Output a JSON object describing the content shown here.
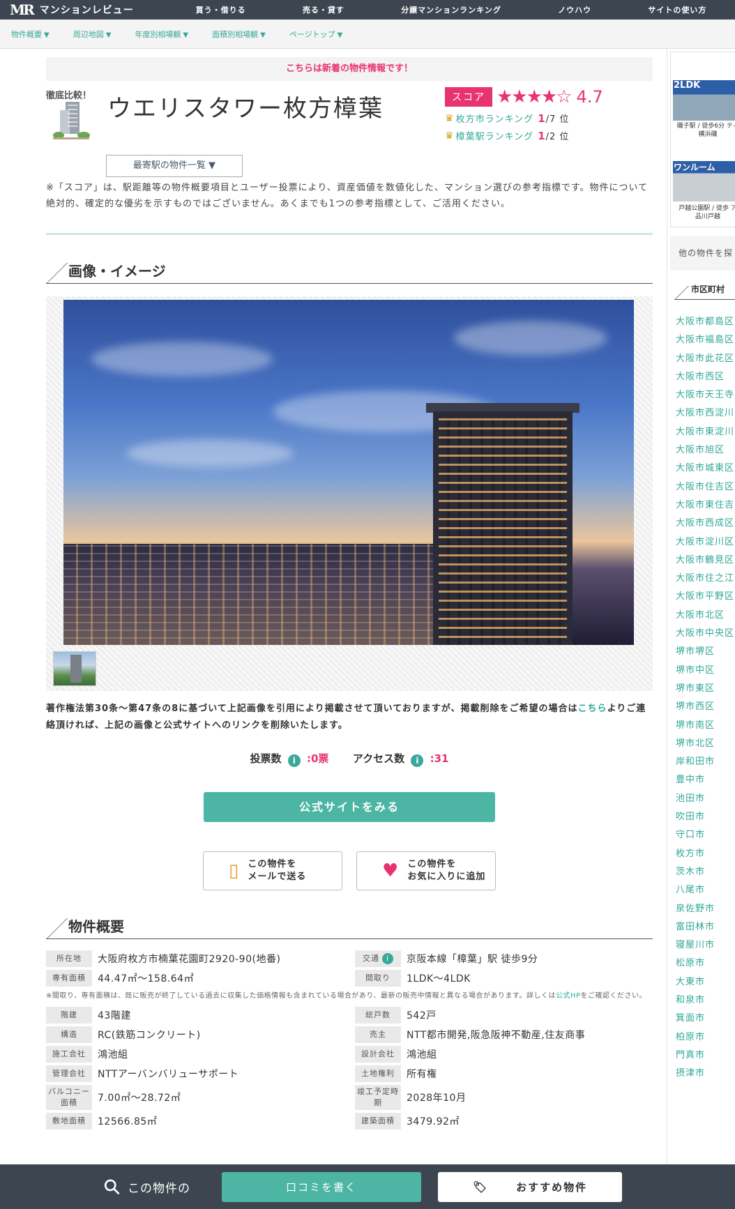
{
  "header": {
    "logo_mark": "MR",
    "site_name": "マンションレビュー",
    "nav": [
      "買う・借りる",
      "売る・貸す",
      "分譲マンションランキング",
      "ノウハウ",
      "サイトの使い方"
    ]
  },
  "subnav": [
    "物件概要",
    "周辺地図",
    "年度別相場観",
    "面積別相場観",
    "ページトップ"
  ],
  "notice": "こちらは新着の物件情報です！",
  "property": {
    "compare_label": "徹底比較！",
    "name": "ウエリスタワー枚方樟葉",
    "nearest_button": "最寄駅の物件一覧 ▼",
    "score_label": "スコア",
    "stars": "★★★★☆",
    "score": "4.7",
    "rankings": [
      {
        "label": "枚方市ランキング",
        "rank": "1",
        "total": "/7 位"
      },
      {
        "label": "樟葉駅ランキング",
        "rank": "1",
        "total": "/2 位"
      }
    ]
  },
  "description": "※「スコア」は、駅距離等の物件概要項目とユーザー投票により、資産価値を数値化した、マンション選びの参考指標です。物件について絶対的、確定的な優劣を示すものではございません。あくまでも1つの参考指標として、ご活用ください。",
  "images_section_title": "画像・イメージ",
  "copyright": {
    "text1": "著作権法第30条～第47条の8に基づいて上記画像を引用により掲載させて頂いておりますが、掲載削除をご希望の場合は",
    "link": "こちら",
    "text2": "よりご連絡頂ければ、上記の画像と公式サイトへのリンクを削除いたします。"
  },
  "counts": {
    "votes_label": "投票数",
    "votes_value": ":0票",
    "access_label": "アクセス数",
    "access_value": ":31"
  },
  "official_button": "公式サイトをみる",
  "actions": {
    "mail": [
      "この物件を",
      "メールで送る"
    ],
    "fav": [
      "この物件を",
      "お気に入りに追加"
    ]
  },
  "overview": {
    "title": "物件概要",
    "rows1": [
      {
        "k": "所在地",
        "v": "大阪府枚方市楠葉花園町2920-90(地番)"
      },
      {
        "k": "交通",
        "v": "京阪本線「樟葉」駅 徒歩9分"
      },
      {
        "k": "専有面積",
        "v": "44.47㎡～158.64㎡"
      },
      {
        "k": "間取り",
        "v": "1LDK～4LDK"
      }
    ],
    "note1": "※間取り、専有面積は、既に販売が終了している過去に収集した価格情報も含まれている場合があり、最新の販売中情報と異なる場合があります。詳しくは",
    "note_link": "公式HP",
    "note2": "をご確認ください。",
    "rows2": [
      {
        "k": "階建",
        "v": "43階建"
      },
      {
        "k": "総戸数",
        "v": "542戸"
      },
      {
        "k": "構造",
        "v": "RC(鉄筋コンクリート)"
      },
      {
        "k": "売主",
        "v": "NTT都市開発,阪急阪神不動産,住友商事"
      },
      {
        "k": "施工会社",
        "v": "鴻池組"
      },
      {
        "k": "設計会社",
        "v": "鴻池組"
      },
      {
        "k": "管理会社",
        "v": "NTTアーバンバリューサポート"
      },
      {
        "k": "土地権利",
        "v": "所有権"
      },
      {
        "k": "バルコニー面積",
        "v": "7.00㎡～28.72㎡"
      },
      {
        "k": "竣工予定時期",
        "v": "2028年10月"
      },
      {
        "k": "敷地面積",
        "v": "12566.85㎡"
      },
      {
        "k": "建築面積",
        "v": "3479.92㎡"
      }
    ]
  },
  "sidebar": {
    "ads": [
      {
        "tag": "2LDK",
        "caption": "磯子駅 / 徒歩6分 ティ横浜磯"
      },
      {
        "tag": "ワンルーム",
        "caption": "戸越公園駅 / 徒歩 ア品川戸越"
      }
    ],
    "search_label": "他の物件を探",
    "section_title": "市区町村",
    "cities": [
      "大阪市都島区",
      "大阪市福島区",
      "大阪市此花区",
      "大阪市西区",
      "大阪市天王寺区",
      "大阪市西淀川区",
      "大阪市東淀川区",
      "大阪市旭区",
      "大阪市城東区",
      "大阪市住吉区",
      "大阪市東住吉区",
      "大阪市西成区",
      "大阪市淀川区",
      "大阪市鶴見区",
      "大阪市住之江区",
      "大阪市平野区",
      "大阪市北区",
      "大阪市中央区",
      "堺市堺区",
      "堺市中区",
      "堺市東区",
      "堺市西区",
      "堺市南区",
      "堺市北区",
      "岸和田市",
      "豊中市",
      "池田市",
      "吹田市",
      "守口市",
      "枚方市",
      "茨木市",
      "八尾市",
      "泉佐野市",
      "富田林市",
      "寝屋川市",
      "松原市",
      "大東市",
      "和泉市",
      "箕面市",
      "柏原市",
      "門真市",
      "摂津市"
    ]
  },
  "bottom": {
    "search_label": "この物件の",
    "review_button": "口コミを書く",
    "recommend_button": "おすすめ物件"
  },
  "colors": {
    "accent": "#e8336f",
    "teal": "#4db5a3",
    "bar": "#3d4650"
  }
}
